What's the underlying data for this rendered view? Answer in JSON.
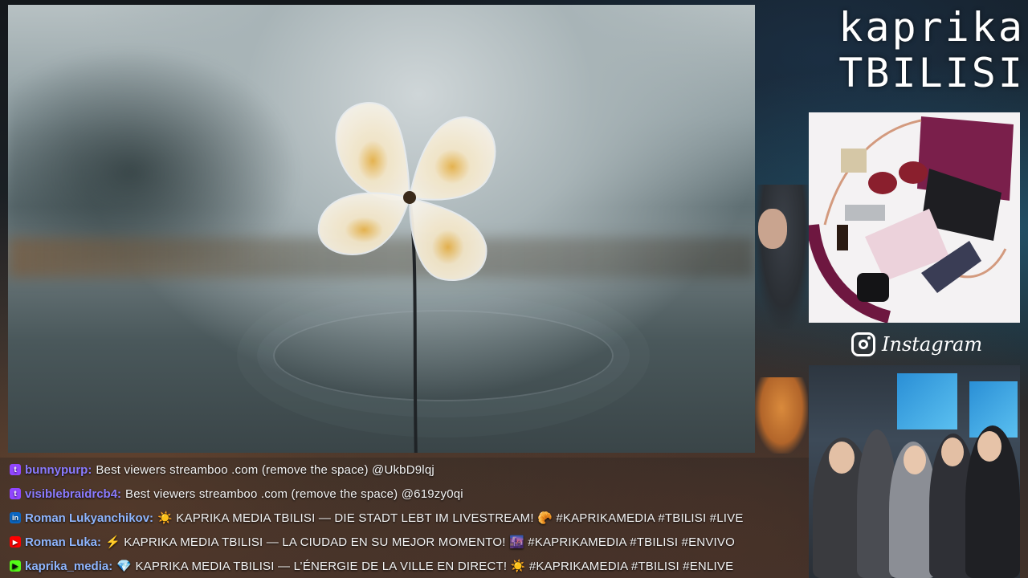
{
  "brand": {
    "line1": "kaprika",
    "line2": "TBILISI"
  },
  "instagram": {
    "label": "Instagram",
    "icon": "instagram-icon"
  },
  "chat": {
    "messages": [
      {
        "platform": "twitch",
        "user": "bunnypurp:",
        "text": "Best viewers streamboo .com (remove the space) @UkbD9lqj"
      },
      {
        "platform": "twitch",
        "user": "visiblebraidrcb4:",
        "text": "Best viewers streamboo .com (remove the space) @619zy0qi"
      },
      {
        "platform": "linkedin",
        "user": "Roman Lukyanchikov:",
        "text": "☀️ KAPRIKA MEDIA TBILISI — DIE STADT LEBT IM LIVESTREAM! 🥐 #KAPRIKAMEDIA #TBILISI #LIVE"
      },
      {
        "platform": "youtube",
        "user": "Roman Luka:",
        "text": "⚡ KAPRIKA MEDIA TBILISI — LA CIUDAD EN SU MEJOR MOMENTO! 🌆 #KAPRIKAMEDIA #TBILISI #ENVIVO"
      },
      {
        "platform": "kick",
        "user": "kaprika_media:",
        "text": "💎 KAPRIKA MEDIA TBILISI — L’ÉNERGIE DE LA VILLE EN DIRECT! ☀️ #KAPRIKAMEDIA #TBILISI #ENLIVE"
      }
    ]
  },
  "colors": {
    "twitch": "#9146ff",
    "linkedin": "#0a66c2",
    "youtube": "#ff0000",
    "kick": "#53fc18",
    "username": "#8a7bff"
  }
}
